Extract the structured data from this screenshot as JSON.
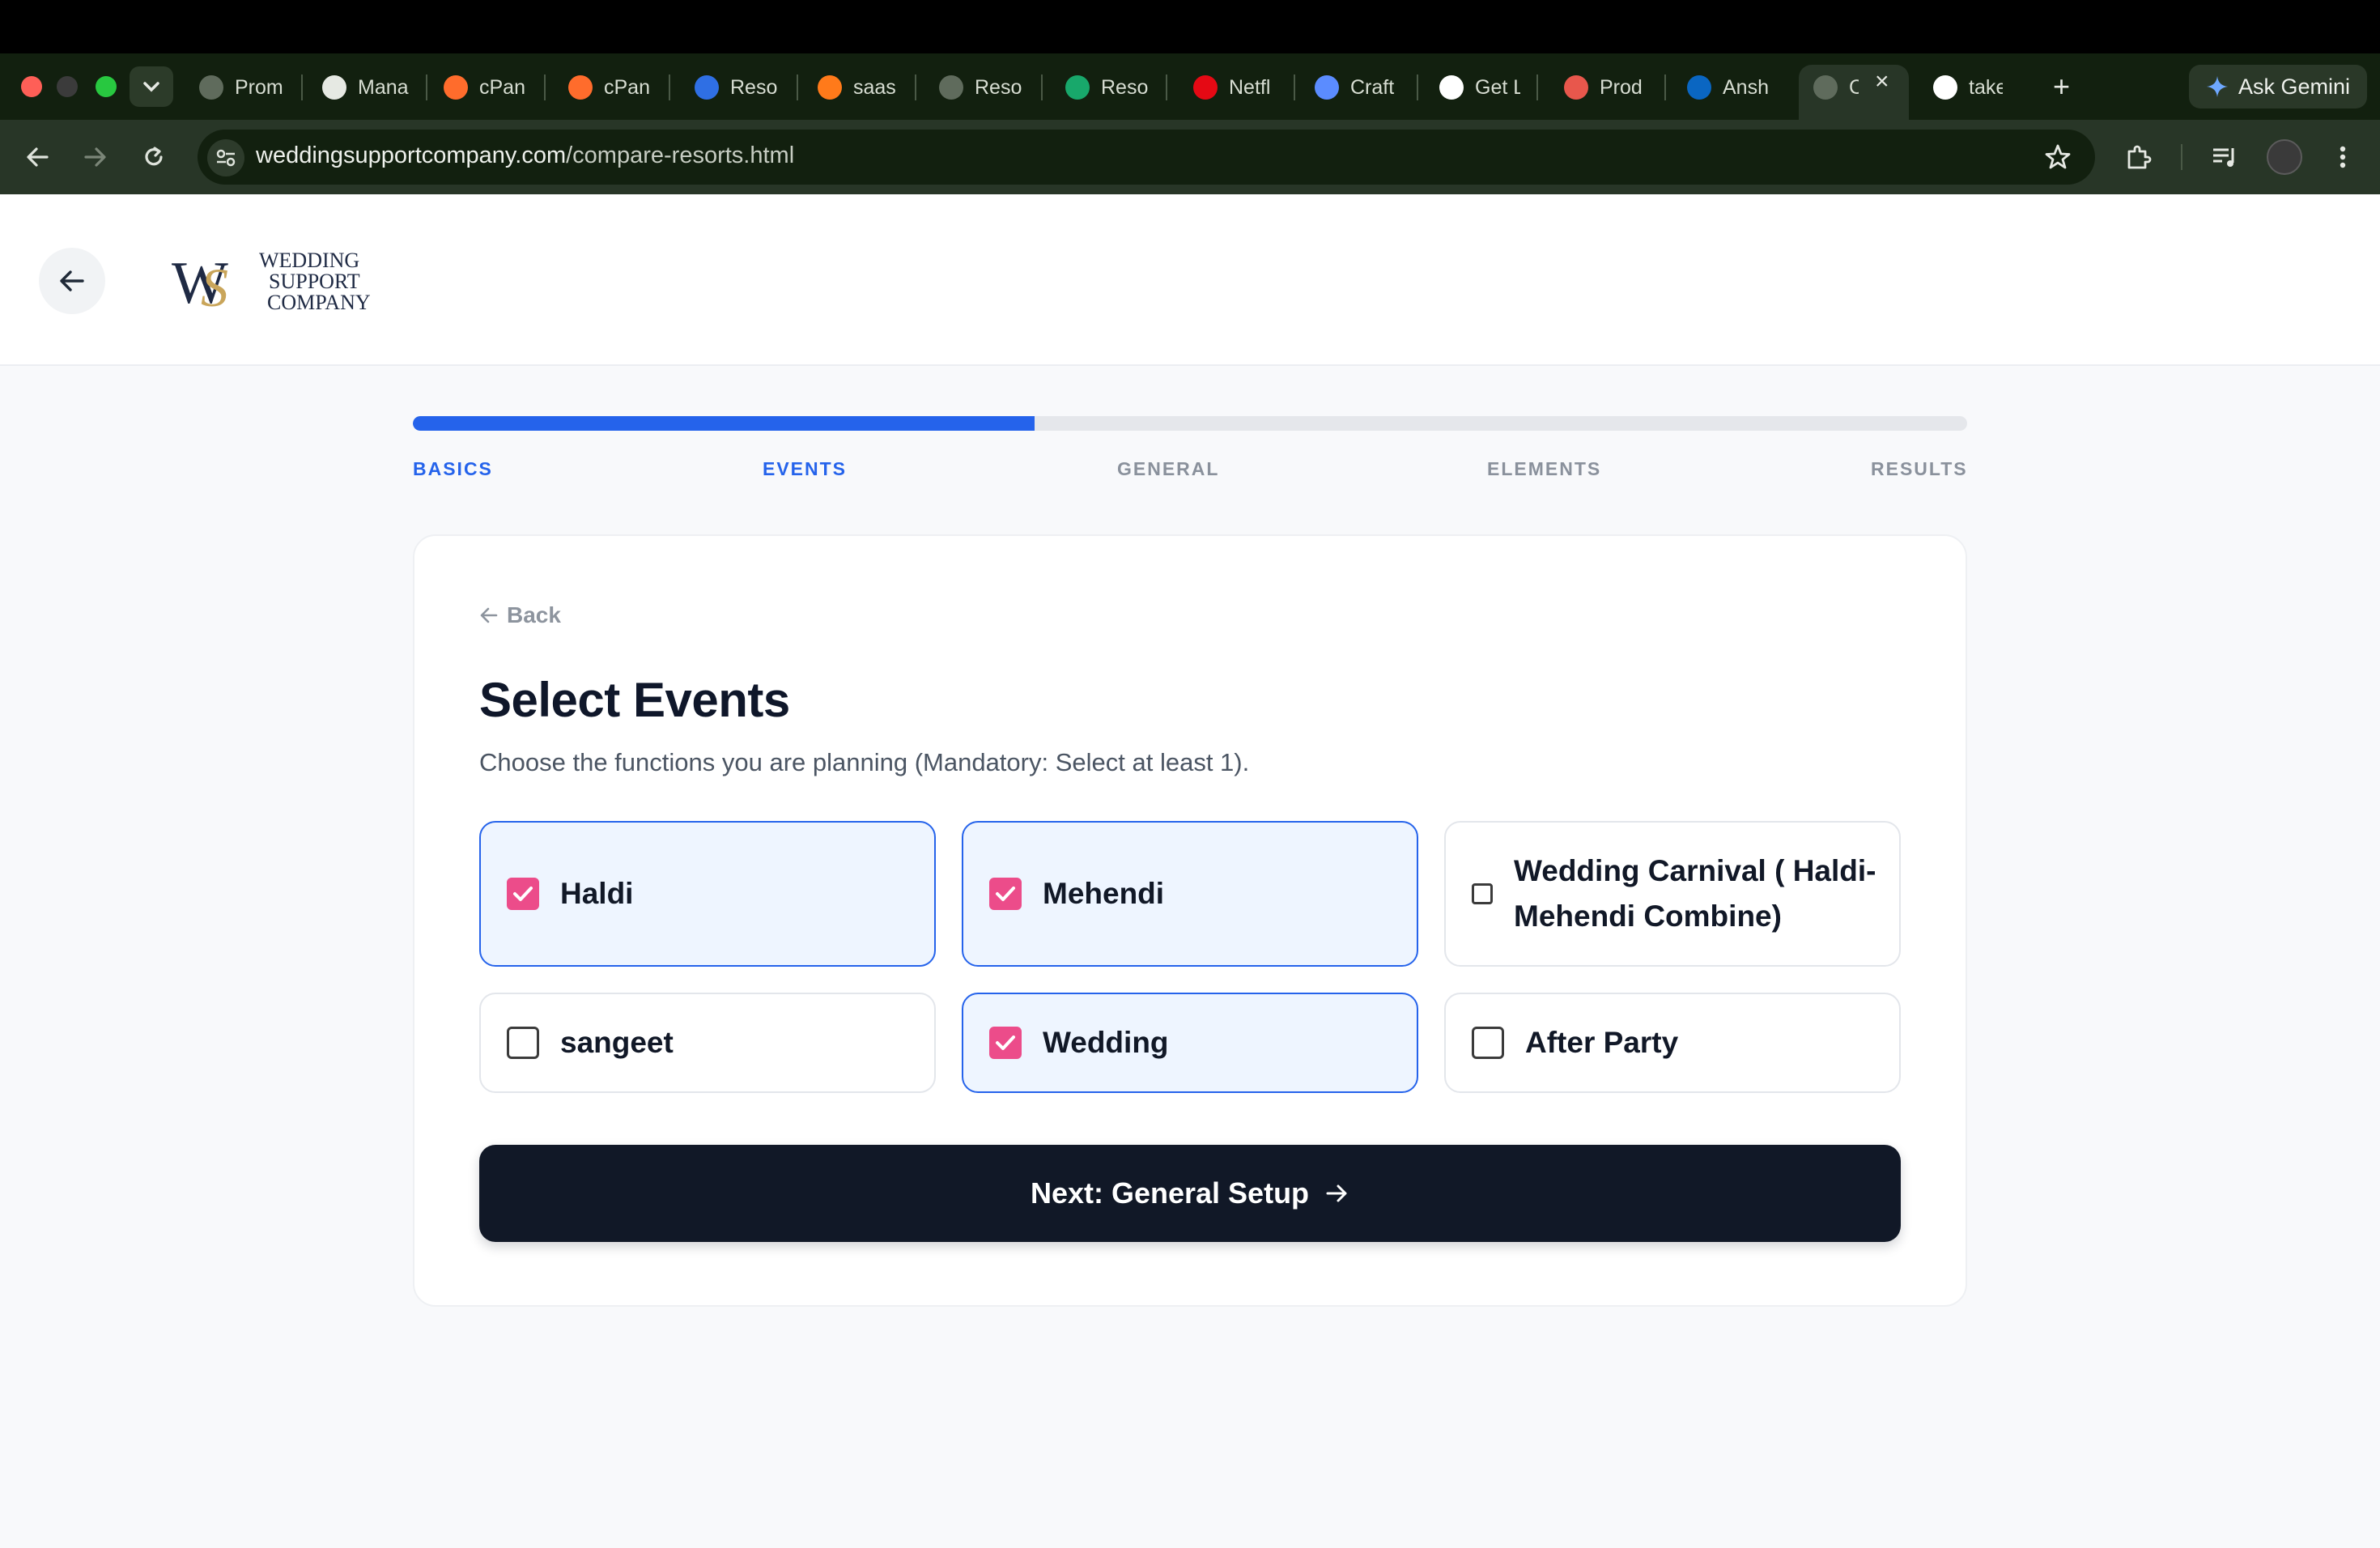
{
  "browser": {
    "tabs": [
      {
        "label": "Prom",
        "favicon": "globe-icon"
      },
      {
        "label": "Mana",
        "favicon": "book-icon"
      },
      {
        "label": "cPan",
        "favicon": "cpanel-icon"
      },
      {
        "label": "cPan",
        "favicon": "cpanel-icon"
      },
      {
        "label": "Reso",
        "favicon": "s-logo-icon"
      },
      {
        "label": "saas",
        "favicon": "flame-icon"
      },
      {
        "label": "Reso",
        "favicon": "globe-icon"
      },
      {
        "label": "Reso",
        "favicon": "plus-tile-icon"
      },
      {
        "label": "Netfl",
        "favicon": "netflix-icon"
      },
      {
        "label": "Craft",
        "favicon": "sparkle-icon"
      },
      {
        "label": "Get L",
        "favicon": "google-icon"
      },
      {
        "label": "Prod",
        "favicon": "p-icon"
      },
      {
        "label": "Ansh",
        "favicon": "linkedin-icon"
      },
      {
        "label": "C",
        "favicon": "globe-icon",
        "active": true
      },
      {
        "label": "take",
        "favicon": "google-icon"
      }
    ],
    "gemini_label": "Ask Gemini",
    "url_host": "weddingsupportcompany.com",
    "url_path": "/compare-resorts.html"
  },
  "site": {
    "logo_text": [
      "WEDDING",
      "SUPPORT",
      "COMPANY"
    ],
    "logo_monogram": "WS"
  },
  "stepper": {
    "progress_fraction": 0.4,
    "steps": [
      {
        "label": "BASICS",
        "state": "done"
      },
      {
        "label": "EVENTS",
        "state": "done"
      },
      {
        "label": "GENERAL",
        "state": "todo"
      },
      {
        "label": "ELEMENTS",
        "state": "todo"
      },
      {
        "label": "RESULTS",
        "state": "todo"
      }
    ]
  },
  "card": {
    "back_label": "Back",
    "title": "Select Events",
    "subtitle": "Choose the functions you are planning (Mandatory: Select at least 1).",
    "options": [
      {
        "label": "Haldi",
        "checked": true
      },
      {
        "label": "Mehendi",
        "checked": true
      },
      {
        "label": "Wedding Carnival ( Haldi-Mehendi Combine)",
        "checked": false
      },
      {
        "label": "sangeet",
        "checked": false
      },
      {
        "label": "Wedding",
        "checked": true
      },
      {
        "label": "After Party",
        "checked": false
      }
    ],
    "next_label": "Next: General Setup"
  },
  "colors": {
    "accent": "#2563eb",
    "checkbox_checked": "#ec4c8a",
    "button_dark": "#111827",
    "logo_gold": "#c9a55a",
    "logo_navy": "#1f2a44"
  }
}
